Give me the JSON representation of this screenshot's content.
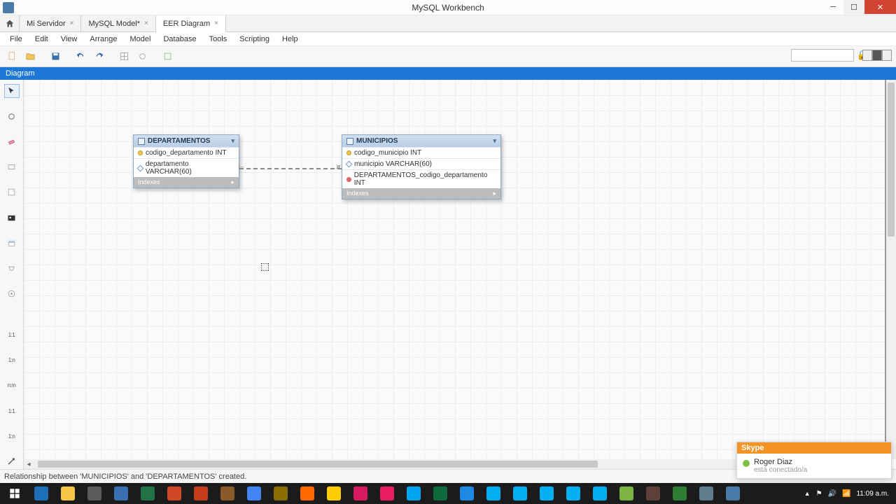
{
  "window": {
    "title": "MySQL Workbench"
  },
  "tabs": [
    {
      "label": "Mi Servidor"
    },
    {
      "label": "MySQL Model*"
    },
    {
      "label": "EER Diagram"
    }
  ],
  "menu": [
    "File",
    "Edit",
    "View",
    "Arrange",
    "Model",
    "Database",
    "Tools",
    "Scripting",
    "Help"
  ],
  "diagram_header": "Diagram",
  "palette_text": [
    "1:1",
    "1:n",
    "n:m",
    "1:1",
    "1:n"
  ],
  "entities": {
    "dept": {
      "name": "DEPARTAMENTOS",
      "cols": [
        {
          "icon": "pk",
          "text": "codigo_departamento INT"
        },
        {
          "icon": "col",
          "text": "departamento VARCHAR(60)"
        }
      ],
      "footer": "Indexes"
    },
    "muni": {
      "name": "MUNICIPIOS",
      "cols": [
        {
          "icon": "pk",
          "text": "codigo_municipio INT"
        },
        {
          "icon": "col",
          "text": "municipio VARCHAR(60)"
        },
        {
          "icon": "fk",
          "text": "DEPARTAMENTOS_codigo_departamento INT"
        }
      ],
      "footer": "Indexes"
    }
  },
  "status": "Relationship between 'MUNICIPIOS' and 'DEPARTAMENTOS' created.",
  "skype": {
    "brand": "Skype",
    "name": "Roger Diaz",
    "sub": "está conectado/a"
  },
  "taskbar": {
    "icons": [
      {
        "c": "#1e6fb8"
      },
      {
        "c": "#f3c548"
      },
      {
        "c": "#5b5b5b"
      },
      {
        "c": "#3a6fb0"
      },
      {
        "c": "#217346"
      },
      {
        "c": "#d24726"
      },
      {
        "c": "#c43e1c"
      },
      {
        "c": "#8a5a2b"
      },
      {
        "c": "#4285f4"
      },
      {
        "c": "#8b6e00"
      },
      {
        "c": "#ff6a00"
      },
      {
        "c": "#ffcc00"
      },
      {
        "c": "#d81b60"
      },
      {
        "c": "#e91e63"
      },
      {
        "c": "#00a4ef"
      },
      {
        "c": "#0f6b3e"
      },
      {
        "c": "#1e88e5"
      },
      {
        "c": "#00aff0"
      },
      {
        "c": "#00aff0"
      },
      {
        "c": "#00aff0"
      },
      {
        "c": "#00aff0"
      },
      {
        "c": "#00aff0"
      },
      {
        "c": "#7cb342"
      },
      {
        "c": "#5d4037"
      },
      {
        "c": "#2e7d32"
      },
      {
        "c": "#607d8b"
      },
      {
        "c": "#4a7aa8"
      }
    ],
    "time": "11:09 a.m."
  }
}
